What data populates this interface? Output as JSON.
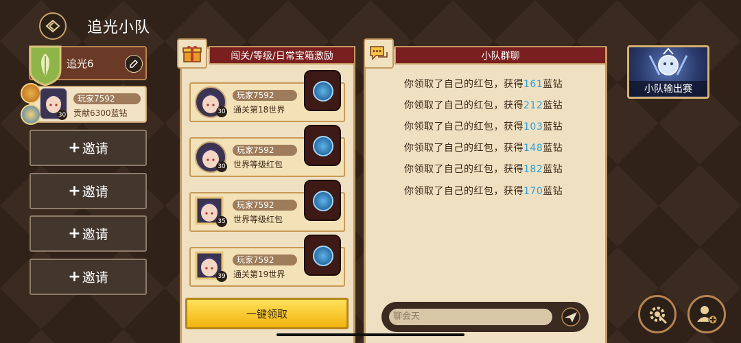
{
  "header": {
    "title": "追光小队"
  },
  "team": {
    "name": "追光6",
    "member": {
      "name": "玩家7592",
      "contribution": "贡献6300蓝钻",
      "level": "30"
    },
    "invite_label": "邀请",
    "invite_slots": 4
  },
  "rewards_panel": {
    "title": "闯关/等级/日常宝箱激励",
    "rows": [
      {
        "name": "玩家7592",
        "level": "30",
        "desc": "通关第18世界"
      },
      {
        "name": "玩家7592",
        "level": "30",
        "desc": "世界等级红包"
      },
      {
        "name": "玩家7592",
        "level": "35",
        "desc": "世界等级红包"
      },
      {
        "name": "玩家7592",
        "level": "39",
        "desc": "通关第19世界"
      }
    ],
    "claim_all_label": "一键领取"
  },
  "chat_panel": {
    "title": "小队群聊",
    "messages": [
      {
        "prefix": "你领取了自己的红包，获得",
        "amount": "161",
        "suffix": "蓝钻"
      },
      {
        "prefix": "你领取了自己的红包，获得",
        "amount": "212",
        "suffix": "蓝钻"
      },
      {
        "prefix": "你领取了自己的红包，获得",
        "amount": "103",
        "suffix": "蓝钻"
      },
      {
        "prefix": "你领取了自己的红包，获得",
        "amount": "148",
        "suffix": "蓝钻"
      },
      {
        "prefix": "你领取了自己的红包，获得",
        "amount": "182",
        "suffix": "蓝钻"
      },
      {
        "prefix": "你领取了自己的红包，获得",
        "amount": "170",
        "suffix": "蓝钻"
      }
    ],
    "input_placeholder": "聊会天"
  },
  "side": {
    "contest_label": "小队输出赛"
  },
  "colors": {
    "accent_gold": "#c39a63",
    "header_red": "#7a1f1f",
    "chat_amount": "#2a9fd6",
    "claim_yellow": "#ffd52e"
  }
}
